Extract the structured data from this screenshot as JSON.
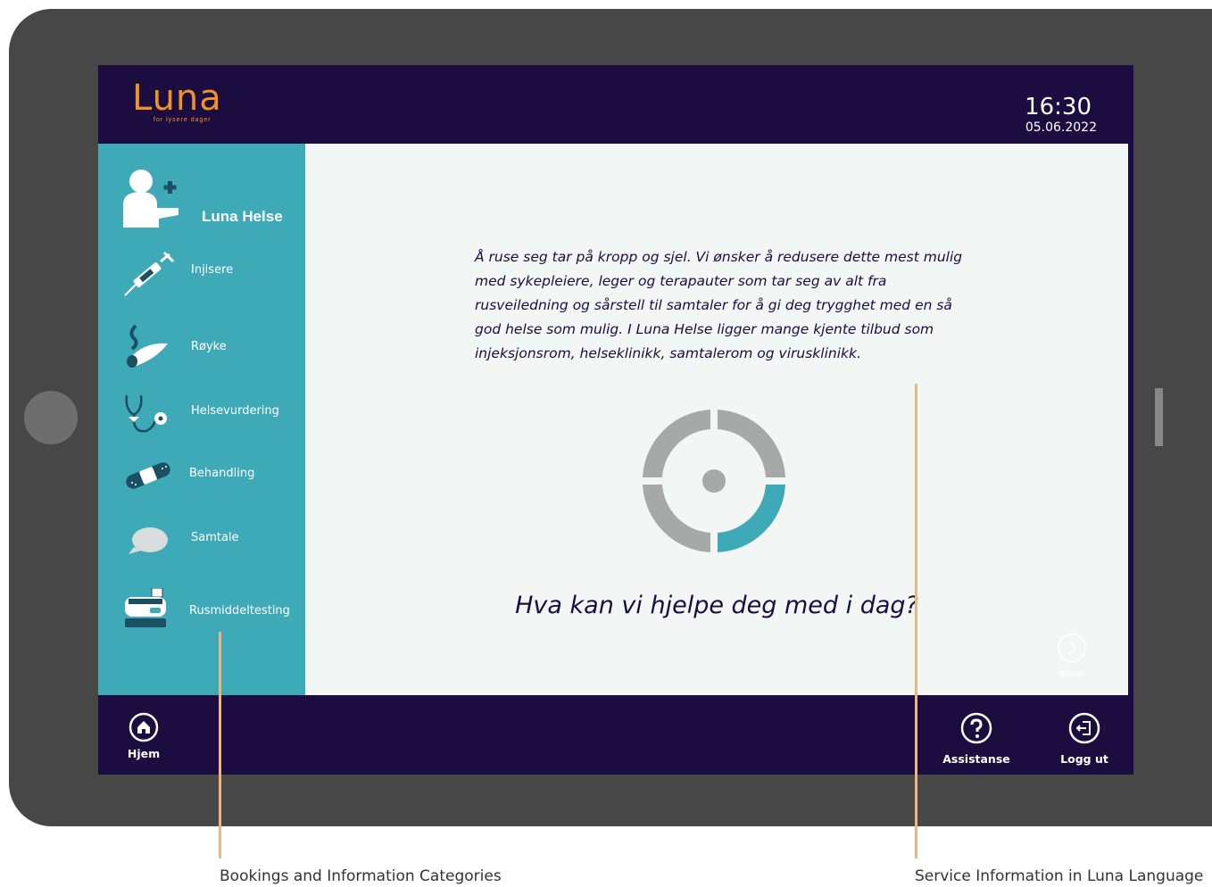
{
  "header": {
    "logo_text": "Luna",
    "logo_tagline": "for lysere dager",
    "time": "16:30",
    "date": "05.06.2022"
  },
  "sidebar": {
    "title": "Luna Helse",
    "items": [
      {
        "label": "Injisere",
        "icon": "syringe-icon"
      },
      {
        "label": "Røyke",
        "icon": "smoking-pipe-icon"
      },
      {
        "label": "Helsevurdering",
        "icon": "stethoscope-icon"
      },
      {
        "label": "Behandling",
        "icon": "bandage-icon"
      },
      {
        "label": "Samtale",
        "icon": "speech-bubble-icon"
      },
      {
        "label": "Rusmiddeltesting",
        "icon": "drug-test-machine-icon"
      }
    ]
  },
  "main": {
    "description": "Å ruse seg tar på kropp og sjel. Vi ønsker å redusere dette mest mulig med sykepleiere, leger og terapauter som tar seg av alt fra rusveiledning og sårstell til samtaler for å gi deg trygghet med en så god helse som mulig. I Luna Helse ligger mange kjente tilbud som injeksjonsrom, helseklinikk, samtalerom og virusklinikk.",
    "question": "Hva kan vi hjelpe deg med i dag?",
    "book_label": "Book"
  },
  "footer": {
    "home_label": "Hjem",
    "assist_label": "Assistanse",
    "logout_label": "Logg ut"
  },
  "annotations": {
    "left": "Bookings and Information Categories",
    "right": "Service Information in Luna Language"
  },
  "colors": {
    "navy": "#1b0d40",
    "teal": "#3ea9b7",
    "orange": "#f0922c",
    "panel": "#f2f6f5",
    "annotation_line": "#efb57e",
    "device": "#474747"
  }
}
